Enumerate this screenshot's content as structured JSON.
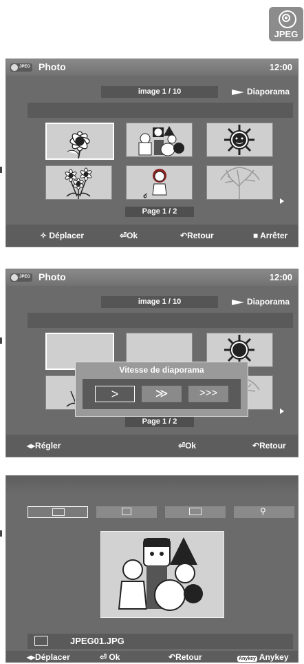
{
  "badge": {
    "label": "JPEG",
    "icon": "disc-icon"
  },
  "screen1": {
    "title": "Photo",
    "clock": "12:00",
    "image_counter": "image 1 / 10",
    "slideshow_label": "Diaporama",
    "page_label": "Page 1 / 2",
    "thumbnails": [
      "flower",
      "halloween-kids",
      "sun",
      "daisies",
      "girl",
      "tree"
    ],
    "footer": {
      "move": "Déplacer",
      "ok": "Ok",
      "back": "Retour",
      "stop": "Arrêter"
    }
  },
  "screen2": {
    "title": "Photo",
    "clock": "12:00",
    "image_counter": "image 1 / 10",
    "slideshow_label": "Diaporama",
    "page_label": "Page 1 / 2",
    "dialog_title": "Vitesse de diaporama",
    "speeds": [
      ">",
      "≫",
      ">>>"
    ],
    "footer": {
      "adjust": "Régler",
      "ok": "Ok",
      "back": "Retour"
    }
  },
  "screen3": {
    "tools": [
      "grid-icon",
      "copy-icon",
      "rotate-icon",
      "zoom-icon"
    ],
    "filename": "JPEG01.JPG",
    "footer": {
      "move": "Déplacer",
      "ok": "Ok",
      "back": "Retour",
      "anykey_badge": "Anykey",
      "anykey": "Anykey"
    }
  }
}
